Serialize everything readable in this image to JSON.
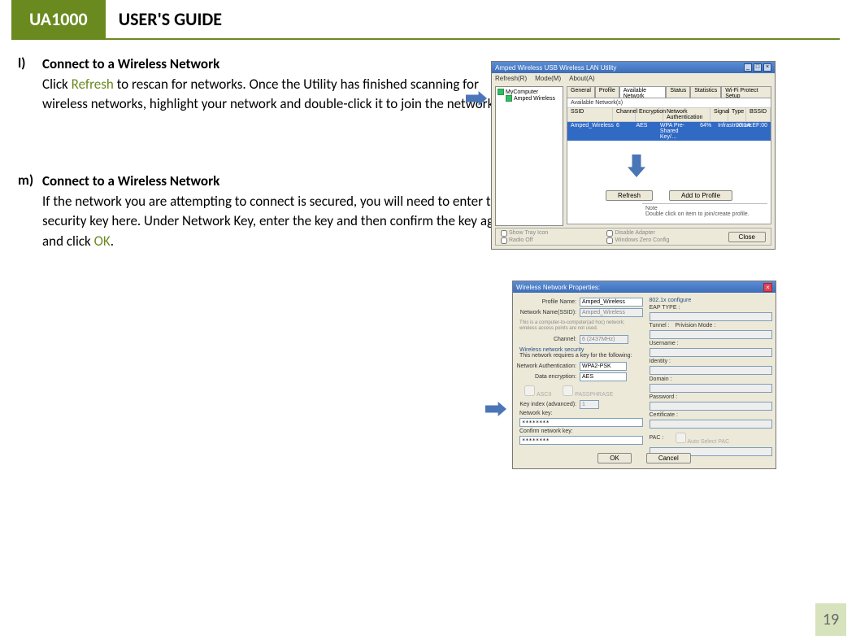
{
  "header": {
    "brand": "UA1000",
    "title": "USER'S GUIDE"
  },
  "page_number": "19",
  "sec_l": {
    "label": "l)",
    "title": "Connect to a Wireless Network",
    "p1a": "Click ",
    "refresh": "Refresh",
    "p1b": " to rescan for networks. Once the Utility has finished scanning for wireless networks, highlight your network and double-click it to join the network."
  },
  "sec_m": {
    "label": "m)",
    "title": "Connect to a Wireless Network",
    "p1a": "If the network you are attempting to connect is secured, you will need to enter the security key here.  Under Network Key, enter the key and then confirm the key again and click ",
    "ok": "OK",
    "p1b": "."
  },
  "shot1": {
    "title": "Amped Wireless USB Wireless LAN Utility",
    "menus": [
      "Refresh(R)",
      "Mode(M)",
      "About(A)"
    ],
    "tree": {
      "root": "MyComputer",
      "child": "Amped Wireless"
    },
    "tabs": [
      "General",
      "Profile",
      "Available Network",
      "Status",
      "Statistics",
      "Wi-Fi Protect Setup"
    ],
    "active_tab": 2,
    "avail_label": "Available Network(s)",
    "cols": [
      "SSID",
      "Channel",
      "Encryption",
      "Network Authentication",
      "Signal",
      "Type",
      "BSSID"
    ],
    "row": [
      "Amped_Wireless",
      "6",
      "AES",
      "WPA Pre-Shared Key/…",
      "64%",
      "Infrastructure",
      "00:1A:EF:00"
    ],
    "btn_refresh": "Refresh",
    "btn_add": "Add to Profile",
    "note_title": "Note",
    "note": "Double click on item to join/create profile.",
    "chk": [
      "Show Tray Icon",
      "Radio Off",
      "Disable Adapter",
      "Windows Zero Config"
    ],
    "close": "Close"
  },
  "shot2": {
    "title": "Wireless Network Properties:",
    "profile_name_label": "Profile Name:",
    "profile_name": "Amped_Wireless",
    "ssid_label": "Network Name(SSID):",
    "ssid": "Amped_Wireless",
    "adhoc_hint": "This is a computer-to-computer(ad hoc) network; wireless access points are not used.",
    "channel_label": "Channel:",
    "channel": "6 (2437MHz)",
    "sec_title": "Wireless network security",
    "sec_req": "This network requires a key for the following:",
    "auth_label": "Network Authentication:",
    "auth": "WPA2-PSK",
    "enc_label": "Data encryption:",
    "enc": "AES",
    "ascii": "ASCII",
    "pass": "PASSPHRASE",
    "keyidx_label": "Key index (advanced):",
    "keyidx": "1",
    "netkey_label": "Network key:",
    "netkey": "********",
    "confirm_label": "Confirm network key:",
    "confirm": "********",
    "r_title": "802.1x configure",
    "eap_label": "EAP TYPE :",
    "tunnel_label": "Tunnel :",
    "prov_label": "Privision Mode :",
    "user_label": "Username :",
    "ident_label": "Identity :",
    "domain_label": "Domain :",
    "pwd_label": "Password :",
    "cert_label": "Certificate :",
    "pac_label": "PAC :",
    "pac_chk": "Auto Select PAC",
    "ok": "OK",
    "cancel": "Cancel"
  }
}
